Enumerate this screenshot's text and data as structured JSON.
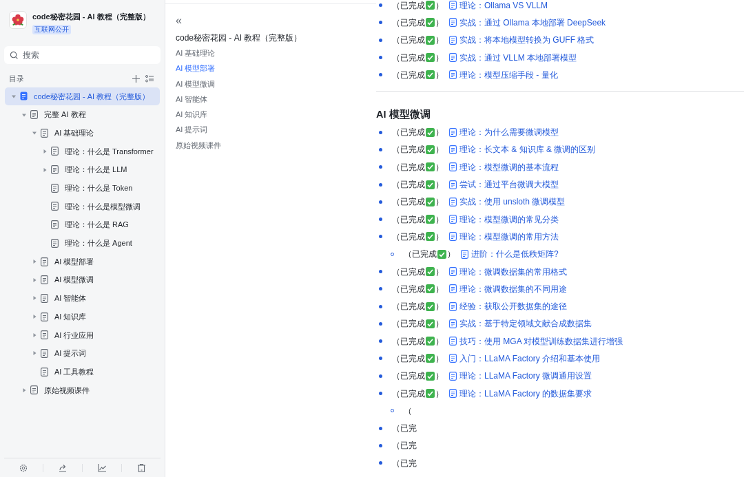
{
  "sidebar": {
    "title": "code秘密花园 - AI 教程（完整版）",
    "badge": "互联网公开",
    "search": {
      "placeholder": "搜索"
    },
    "toc_label": "目录",
    "tree": [
      {
        "label": "code秘密花园 - AI 教程（完整版）",
        "expanded": true,
        "selected": true,
        "children": [
          {
            "label": "完整 AI 教程",
            "expanded": true,
            "selected": false,
            "children": [
              {
                "label": "AI 基础理论",
                "expanded": true,
                "selected": false,
                "children": [
                  {
                    "label": "理论：什么是 Transformer",
                    "expanded": false,
                    "selected": false
                  },
                  {
                    "label": "理论：什么是 LLM",
                    "expanded": false,
                    "selected": false
                  },
                  {
                    "label": "理论：什么是 Token",
                    "selected": false
                  },
                  {
                    "label": "理论：什么是模型微调",
                    "selected": false
                  },
                  {
                    "label": "理论：什么是 RAG",
                    "selected": false
                  },
                  {
                    "label": "理论：什么是 Agent",
                    "selected": false
                  }
                ]
              },
              {
                "label": "AI 模型部署",
                "expanded": false,
                "selected": false
              },
              {
                "label": "AI 模型微调",
                "expanded": false,
                "selected": false
              },
              {
                "label": "AI 智能体",
                "expanded": false,
                "selected": false
              },
              {
                "label": "AI 知识库",
                "expanded": false,
                "selected": false
              },
              {
                "label": "AI 行业应用",
                "expanded": false,
                "selected": false
              },
              {
                "label": "AI 提示词",
                "expanded": false,
                "selected": false
              },
              {
                "label": "AI 工具教程",
                "selected": false
              }
            ]
          },
          {
            "label": "原始视频课件",
            "expanded": false,
            "selected": false
          }
        ]
      }
    ]
  },
  "outline": {
    "collapse": "«",
    "title": "code秘密花园 - AI 教程（完整版）",
    "items": [
      {
        "label": "AI 基础理论",
        "selected": false
      },
      {
        "label": "AI 模型部署",
        "selected": true
      },
      {
        "label": "AI 模型微调",
        "selected": false
      },
      {
        "label": "AI 智能体",
        "selected": false
      },
      {
        "label": "AI 知识库",
        "selected": false
      },
      {
        "label": "AI 提示词",
        "selected": false
      },
      {
        "label": "原始视频课件",
        "selected": false
      }
    ]
  },
  "content": {
    "top_list": [
      {
        "status": "（已完成",
        "done": true,
        "close": "）",
        "link": "理论：Ollama VS VLLM"
      },
      {
        "status": "（已完成",
        "done": true,
        "close": "）",
        "link": "实战：通过 Ollama 本地部署 DeepSeek"
      },
      {
        "status": "（已完成",
        "done": true,
        "close": "）",
        "link": "实战：将本地模型转换为 GUFF 格式"
      },
      {
        "status": "（已完成",
        "done": true,
        "close": "）",
        "link": "实战：通过 VLLM 本地部署模型"
      },
      {
        "status": "（已完成",
        "done": true,
        "close": "）",
        "link": "理论：模型压缩手段 - 量化"
      }
    ],
    "sections": [
      {
        "heading": "AI 模型微调",
        "items": [
          {
            "status": "（已完成",
            "done": true,
            "close": "）",
            "link": "理论：为什么需要微调模型"
          },
          {
            "status": "（已完成",
            "done": true,
            "close": "）",
            "link": "理论：长文本 & 知识库 & 微调的区别"
          },
          {
            "status": "（已完成",
            "done": true,
            "close": "）",
            "link": "理论：模型微调的基本流程"
          },
          {
            "status": "（已完成",
            "done": true,
            "close": "）",
            "link": "尝试：通过平台微调大模型"
          },
          {
            "status": "（已完成",
            "done": true,
            "close": "）",
            "link": "实战：使用 unsloth 微调模型"
          },
          {
            "status": "（已完成",
            "done": true,
            "close": "）",
            "link": "理论：模型微调的常见分类"
          },
          {
            "status": "（已完成",
            "done": true,
            "close": "）",
            "link": "理论：模型微调的常用方法",
            "children": [
              {
                "status": "（已完成",
                "done": true,
                "close": "）",
                "link": "进阶：什么是低秩矩阵?"
              }
            ]
          },
          {
            "status": "（已完成",
            "done": true,
            "close": "）",
            "link": "理论：微调数据集的常用格式"
          },
          {
            "status": "（已完成",
            "done": true,
            "close": "）",
            "link": "理论：微调数据集的不同用途"
          },
          {
            "status": "（已完成",
            "done": true,
            "close": "）",
            "link": "经验：获取公开数据集的途径"
          },
          {
            "status": "（已完成",
            "done": true,
            "close": "）",
            "link": "实战：基于特定领域文献合成数据集"
          },
          {
            "status": "（已完成",
            "done": true,
            "close": "）",
            "link": "技巧：使用 MGA 对模型训练数据集进行增强"
          },
          {
            "status": "（已完成",
            "done": true,
            "close": "）",
            "link": "入门：LLaMA Factory 介绍和基本使用"
          },
          {
            "status": "（已完成",
            "done": true,
            "close": "）",
            "link": "理论：LLaMA Factory 微调通用设置"
          },
          {
            "status": "（已完成",
            "done": true,
            "close": "）",
            "link": "理论：LLaMA Factory 的数据集要求",
            "children": [
              {
                "status": "（"
              }
            ]
          },
          {
            "status": "（已完"
          },
          {
            "status": "（已完"
          },
          {
            "status": "（已完"
          }
        ]
      }
    ]
  }
}
